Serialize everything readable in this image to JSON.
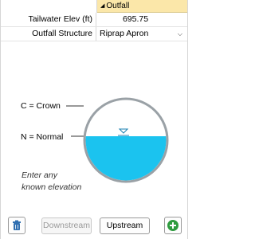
{
  "property_grid": {
    "section_label": "Outfall",
    "rows": [
      {
        "label": "Tailwater Elev (ft)",
        "value": "695.75"
      },
      {
        "label": "Outfall Structure",
        "value": "Riprap Apron"
      }
    ]
  },
  "diagram": {
    "crown_label": "C = Crown",
    "normal_label": "N = Normal",
    "hint": "Enter any known elevation",
    "hint_lines": [
      "Enter any",
      "known elevation"
    ],
    "water_color": "#1bc3ef",
    "pipe_color": "#9aa1a6"
  },
  "toolbar": {
    "delete_icon": "trash-icon",
    "downstream_label": "Downstream",
    "upstream_label": "Upstream",
    "add_icon": "plus-circle-icon",
    "accent_green": "#2e9b3e"
  }
}
